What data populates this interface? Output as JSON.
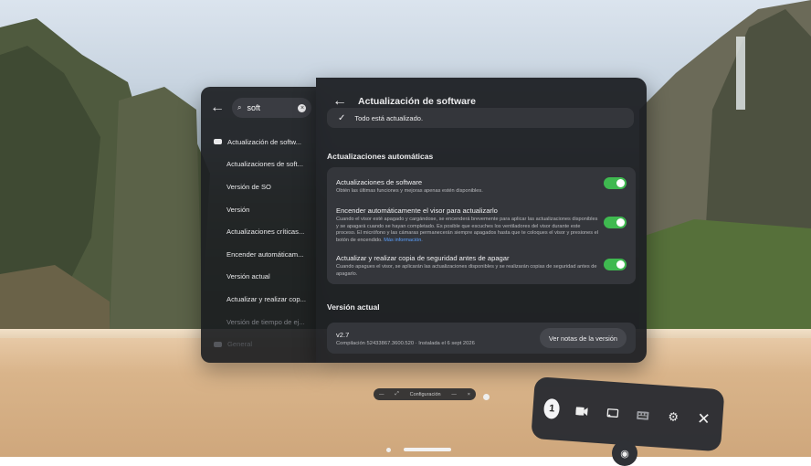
{
  "search": {
    "value": "soft"
  },
  "sidebar": {
    "items": [
      {
        "label": "Actualización de softw..."
      },
      {
        "label": "Actualizaciones de soft..."
      },
      {
        "label": "Versión de SO"
      },
      {
        "label": "Versión"
      },
      {
        "label": "Actualizaciones críticas..."
      },
      {
        "label": "Encender automáticam..."
      },
      {
        "label": "Versión actual"
      },
      {
        "label": "Actualizar y realizar cop..."
      },
      {
        "label": "Versión de tiempo de ej..."
      },
      {
        "label": "General"
      }
    ]
  },
  "main": {
    "title": "Actualización de software",
    "status": "Todo está actualizado.",
    "auto_updates_title": "Actualizaciones automáticas",
    "settings": [
      {
        "title": "Actualizaciones de software",
        "desc": "Obtén las últimas funciones y mejoras apenas estén disponibles.",
        "enabled": true
      },
      {
        "title": "Encender automáticamente el visor para actualizarlo",
        "desc": "Cuando el visor esté apagado y cargándose, se encenderá brevemente para aplicar las actualizaciones disponibles y se apagará cuando se hayan completado. Es posible que escuches los ventiladores del visor durante este proceso. El micrófono y las cámaras permanecerán siempre apagados hasta que te coloques el visor y presiones el botón de encendido.",
        "link": "Más información.",
        "enabled": true
      },
      {
        "title": "Actualizar y realizar copia de seguridad antes de apagar",
        "desc": "Cuando apagues el visor, se aplicarán las actualizaciones disponibles y se realizarán copias de seguridad antes de apagarlo.",
        "enabled": true
      }
    ],
    "current_version_title": "Versión actual",
    "version": "v2.7",
    "build": "Compilación 52433867.3600.520 · Instalada el 6 sept 2026",
    "notes_button": "Ver notas de la versión"
  },
  "mini_bar": {
    "label": "Configuración"
  },
  "dock": {
    "badge": "1"
  },
  "colors": {
    "toggle_on": "#3fb950",
    "panel_bg": "#1e2024",
    "link": "#5aa0ff"
  }
}
